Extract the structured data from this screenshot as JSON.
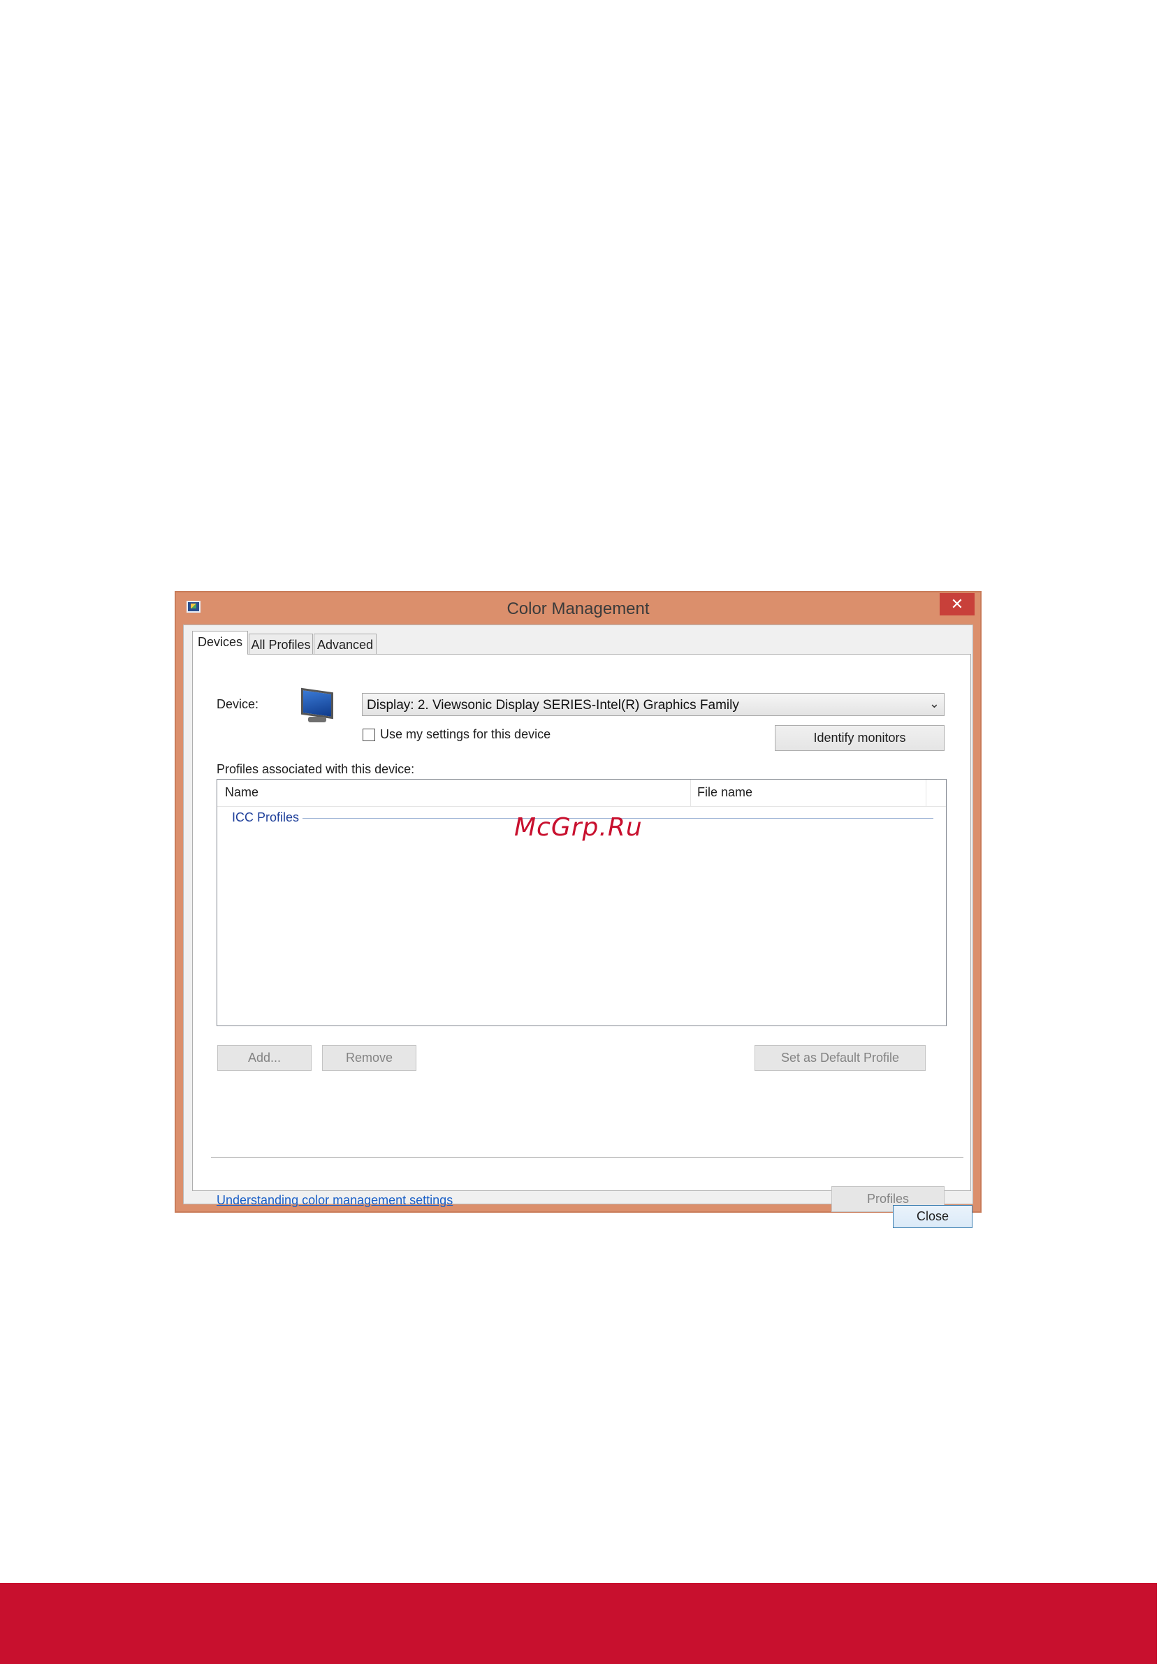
{
  "window": {
    "title": "Color Management",
    "close_glyph": "✕",
    "icon": "color-management-icon"
  },
  "tabs": [
    {
      "label": "Devices",
      "active": true
    },
    {
      "label": "All Profiles",
      "active": false
    },
    {
      "label": "Advanced",
      "active": false
    }
  ],
  "devices": {
    "device_label": "Device:",
    "device_icon": "monitor-icon",
    "device_value": "Display: 2. Viewsonic Display SERIES-Intel(R) Graphics Family",
    "use_settings_label": "Use my settings for this device",
    "use_settings_checked": false,
    "identify_button": "Identify monitors",
    "profiles_label": "Profiles associated with this device:",
    "list": {
      "columns": [
        "Name",
        "File name"
      ],
      "group": "ICC Profiles",
      "rows": []
    },
    "add_button": "Add...",
    "remove_button": "Remove",
    "set_default_button": "Set as Default Profile",
    "profiles_button": "Profiles",
    "help_link": "Understanding color management settings",
    "close_button": "Close"
  },
  "watermark": "McGrp.Ru",
  "colors": {
    "frame": "#db8f6c",
    "close_button": "#c8403a",
    "footer_bar": "#c8102e",
    "link": "#1a5fc7"
  }
}
